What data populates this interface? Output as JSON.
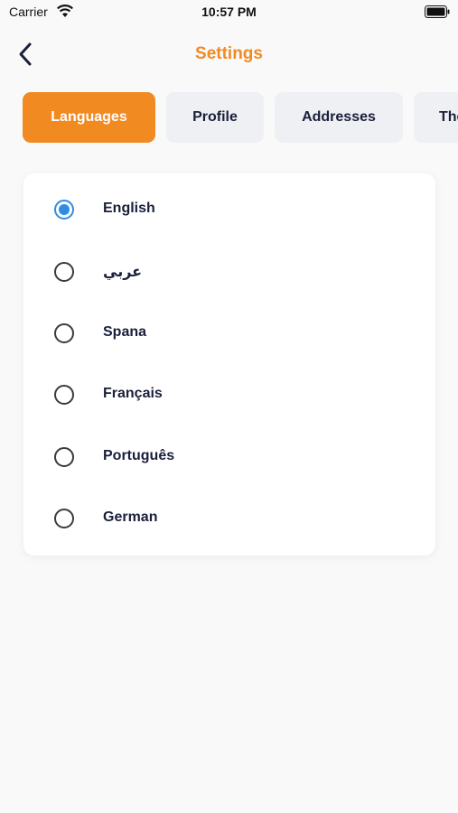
{
  "status_bar": {
    "carrier": "Carrier",
    "time": "10:57 PM"
  },
  "header": {
    "title": "Settings",
    "back_icon": "chevron-left-icon"
  },
  "tabs": [
    {
      "label": "Languages",
      "active": true
    },
    {
      "label": "Profile",
      "active": false
    },
    {
      "label": "Addresses",
      "active": false
    },
    {
      "label": "Theme",
      "active": false
    }
  ],
  "languages": [
    {
      "label": "English",
      "selected": true
    },
    {
      "label": "عربي",
      "selected": false
    },
    {
      "label": "Spana",
      "selected": false
    },
    {
      "label": "Français",
      "selected": false
    },
    {
      "label": "Português",
      "selected": false
    },
    {
      "label": "German",
      "selected": false
    }
  ],
  "colors": {
    "accent": "#f28a22",
    "radio_selected": "#2e8ce6",
    "text": "#1a1f3b"
  }
}
